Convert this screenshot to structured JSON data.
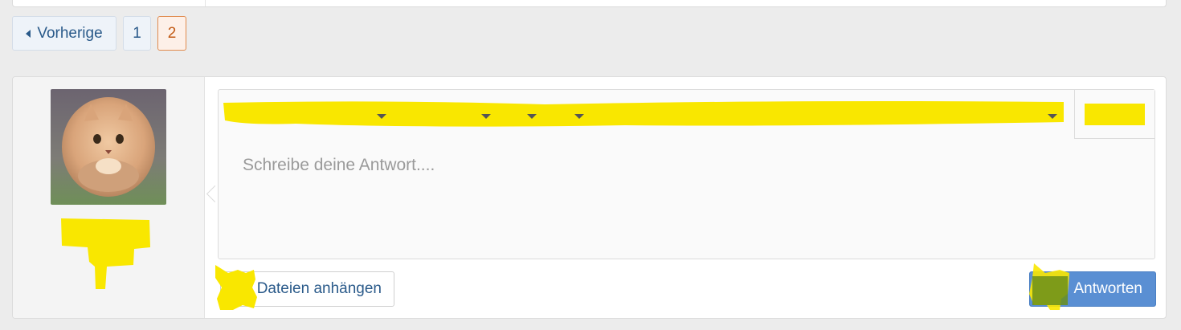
{
  "pagination": {
    "prev_label": "Vorherige",
    "pages": [
      "1",
      "2"
    ],
    "current_page": "2"
  },
  "editor": {
    "placeholder": "Schreibe deine Antwort...."
  },
  "actions": {
    "attach_label": "Dateien anhängen",
    "submit_label": "Antworten"
  },
  "colors": {
    "redaction": "#f9e700",
    "submit_button": "#5a8fd3",
    "current_page_border": "#e08a4d"
  },
  "icons": {
    "prev": "caret-left-icon",
    "dropdown": "caret-down-icon"
  }
}
